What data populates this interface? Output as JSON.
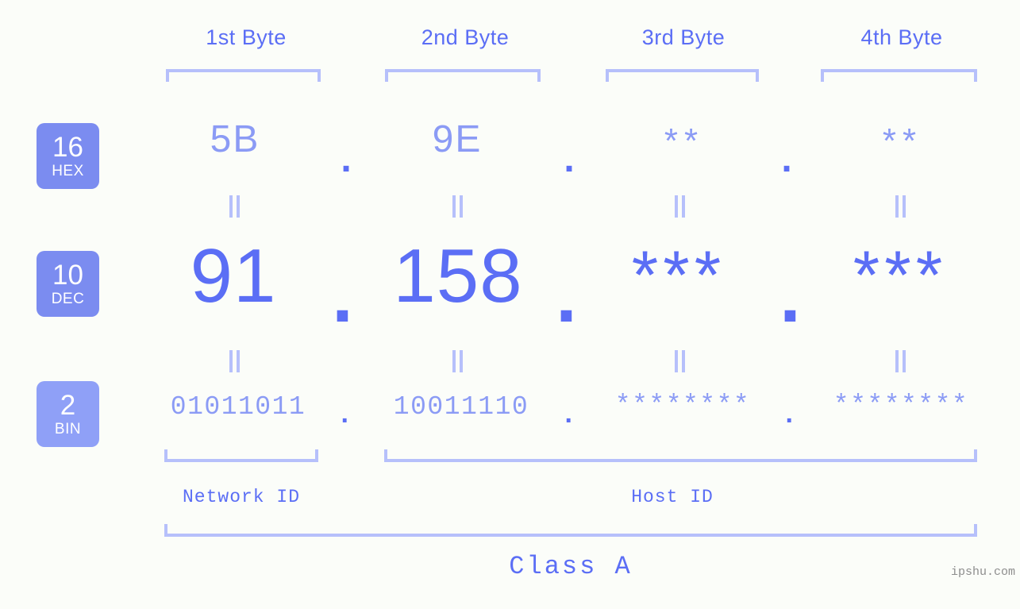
{
  "meta": {
    "background_color": "#fbfdf9",
    "accent_color": "#5b6ef5",
    "muted_accent_color": "#8b9bf5",
    "bracket_color": "#b6c0fb",
    "badge_color": "#7b8cf0",
    "badge_color_light": "#8fa0f7"
  },
  "byte_headers": [
    {
      "label": "1st Byte"
    },
    {
      "label": "2nd Byte"
    },
    {
      "label": "3rd Byte"
    },
    {
      "label": "4th Byte"
    }
  ],
  "bases": [
    {
      "number": "16",
      "name": "HEX"
    },
    {
      "number": "10",
      "name": "DEC"
    },
    {
      "number": "2",
      "name": "BIN"
    }
  ],
  "separator": ".",
  "rows": {
    "hex": {
      "values": [
        "5B",
        "9E",
        "**",
        "**"
      ]
    },
    "dec": {
      "values": [
        "91",
        "158",
        "***",
        "***"
      ]
    },
    "bin": {
      "values": [
        "01011011",
        "10011110",
        "********",
        "********"
      ]
    }
  },
  "equals_marks": [
    "=",
    "=",
    "=",
    "=",
    "=",
    "=",
    "=",
    "="
  ],
  "id_sections": [
    {
      "label": "Network ID"
    },
    {
      "label": "Host ID"
    }
  ],
  "class_label": "Class A",
  "watermark": "ipshu.com"
}
